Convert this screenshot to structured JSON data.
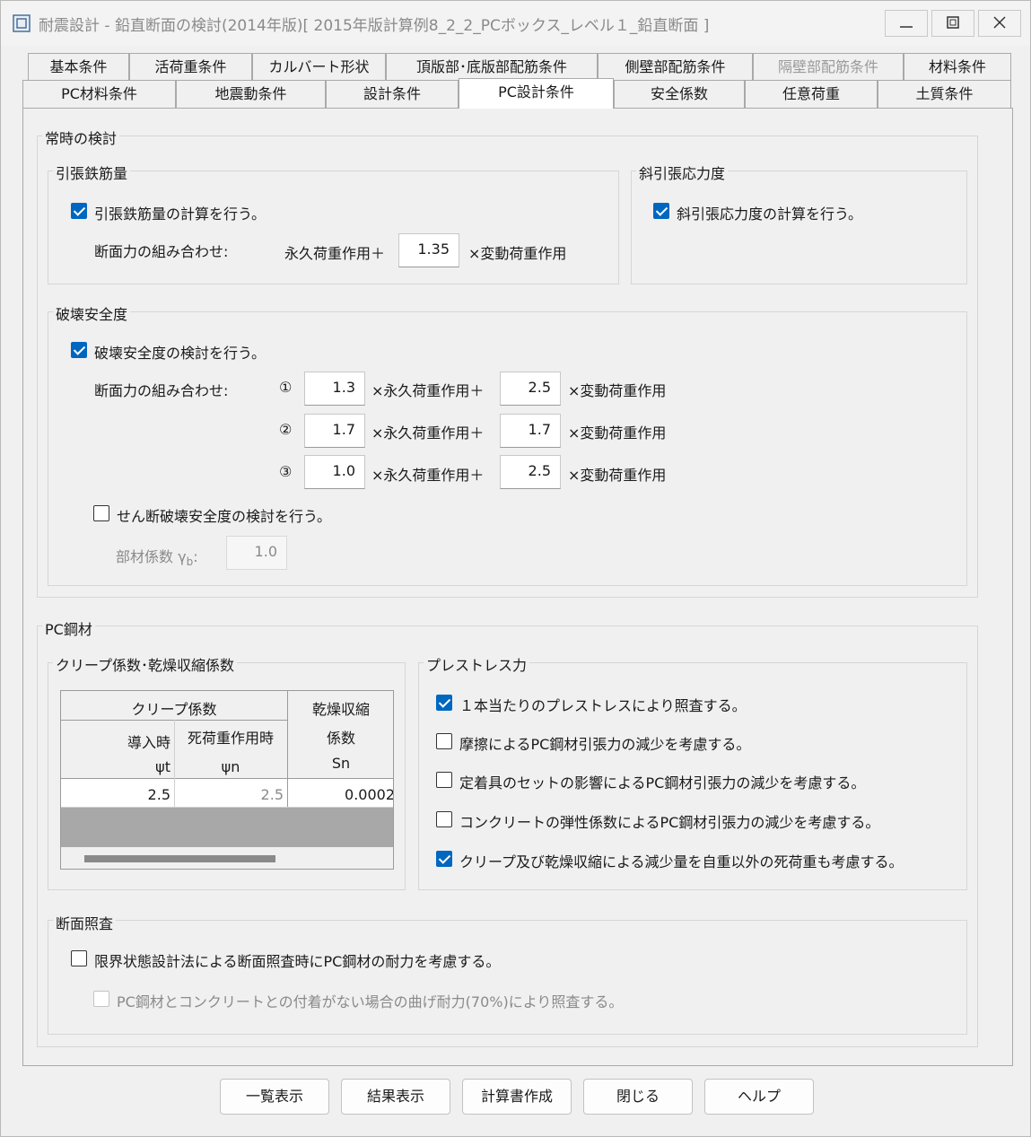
{
  "window": {
    "title": "耐震設計 - 鉛直断面の検討(2014年版)[ 2015年版計算例8_2_2_PCボックス_レベル１_鉛直断面 ]"
  },
  "tabs_row1": [
    {
      "label": "基本条件",
      "disabled": false
    },
    {
      "label": "活荷重条件",
      "disabled": false
    },
    {
      "label": "カルバート形状",
      "disabled": false
    },
    {
      "label": "頂版部･底版部配筋条件",
      "disabled": false
    },
    {
      "label": "側壁部配筋条件",
      "disabled": false
    },
    {
      "label": "隔壁部配筋条件",
      "disabled": true
    },
    {
      "label": "材料条件",
      "disabled": false
    }
  ],
  "tabs_row2": [
    {
      "label": "PC材料条件"
    },
    {
      "label": "地震動条件"
    },
    {
      "label": "設計条件"
    },
    {
      "label": "PC設計条件",
      "active": true
    },
    {
      "label": "安全係数"
    },
    {
      "label": "任意荷重"
    },
    {
      "label": "土質条件"
    }
  ],
  "normal": {
    "label": "常時の検討",
    "tensile": {
      "label": "引張鉄筋量",
      "checkbox": "引張鉄筋量の計算を行う。",
      "checked": true,
      "combo_label": "断面力の組み合わせ:",
      "prefix": "永久荷重作用＋",
      "value": "1.35",
      "suffix": "×変動荷重作用"
    },
    "diagonal": {
      "label": "斜引張応力度",
      "checkbox": "斜引張応力度の計算を行う。",
      "checked": true
    },
    "failure": {
      "label": "破壊安全度",
      "checkbox": "破壊安全度の検討を行う。",
      "checked": true,
      "combo_label": "断面力の組み合わせ:",
      "rows": [
        {
          "mark": "①",
          "a": "1.3",
          "mid": "×永久荷重作用＋",
          "b": "2.5",
          "end": "×変動荷重作用"
        },
        {
          "mark": "②",
          "a": "1.7",
          "mid": "×永久荷重作用＋",
          "b": "1.7",
          "end": "×変動荷重作用"
        },
        {
          "mark": "③",
          "a": "1.0",
          "mid": "×永久荷重作用＋",
          "b": "2.5",
          "end": "×変動荷重作用"
        }
      ],
      "shear_checkbox": "せん断破壊安全度の検討を行う。",
      "shear_checked": false,
      "member_label": "部材係数",
      "member_symbol": "γ",
      "member_sub": "b",
      "member_colon": ":",
      "member_value": "1.0"
    }
  },
  "pc": {
    "label": "PC鋼材",
    "creep": {
      "label": "クリープ係数･乾燥収縮係数",
      "header_creep": "クリープ係数",
      "header_dry1": "乾燥収縮",
      "header_dry2": "係数",
      "col1": "導入時",
      "col2": "死荷重作用時",
      "sym1": "ψt",
      "sym2": "ψn",
      "sym3": "Sn",
      "val1": "2.5",
      "val2": "2.5",
      "val3": "0.0002"
    },
    "prestress": {
      "label": "プレストレス力",
      "items": [
        {
          "text": "１本当たりのプレストレスにより照査する。",
          "checked": true
        },
        {
          "text": "摩擦によるPC鋼材引張力の減少を考慮する。",
          "checked": false
        },
        {
          "text": "定着具のセットの影響によるPC鋼材引張力の減少を考慮する。",
          "checked": false
        },
        {
          "text": "コンクリートの弾性係数によるPC鋼材引張力の減少を考慮する。",
          "checked": false
        },
        {
          "text": "クリープ及び乾燥収縮による減少量を自重以外の死荷重も考慮する。",
          "checked": true
        }
      ]
    }
  },
  "section": {
    "label": "断面照査",
    "checkbox1": "限界状態設計法による断面照査時にPC鋼材の耐力を考慮する。",
    "checked1": false,
    "checkbox2": "PC鋼材とコンクリートとの付着がない場合の曲げ耐力(70%)により照査する。",
    "checked2": false
  },
  "buttons": {
    "list": "一覧表示",
    "result": "結果表示",
    "report": "計算書作成",
    "close": "閉じる",
    "help": "ヘルプ"
  },
  "colors": {
    "accent": "#0067c0",
    "panel_bg": "#f0f0f0",
    "disabled_text": "#8a8a8a"
  }
}
